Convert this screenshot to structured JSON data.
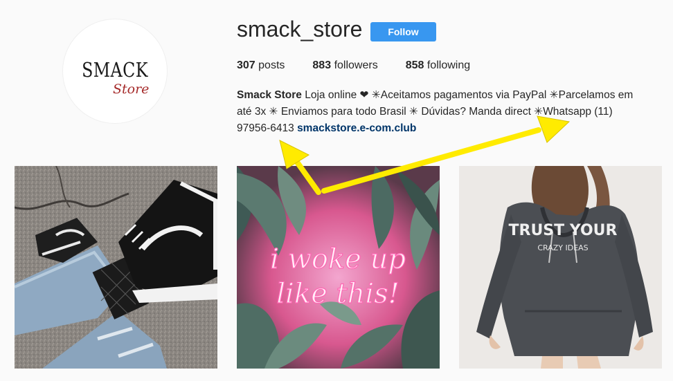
{
  "profile": {
    "username": "smack_store",
    "follow_label": "Follow",
    "avatar": {
      "logo_main": "SMACK",
      "logo_sub": "Store"
    }
  },
  "stats": {
    "posts_count": "307",
    "posts_label": "posts",
    "followers_count": "883",
    "followers_label": "followers",
    "following_count": "858",
    "following_label": "following"
  },
  "bio": {
    "name": "Smack Store",
    "text_line1": " Loja online ❤ ✳Aceitamos pagamentos via PayPal ✳Parcelamos em",
    "text_line2": "até 3x ✳ Enviamos para todo Brasil ✳ Dúvidas? Manda direct ✳Whatsapp (11)",
    "text_line3": "97956-6413 ",
    "link": "smackstore.e-com.club"
  },
  "posts": [
    {
      "image_icon": "sneakers-photo-icon"
    },
    {
      "image_icon": "neon-sign-photo-icon",
      "neon_line1": "i woke up",
      "neon_line2": "like this!"
    },
    {
      "image_icon": "hoodie-photo-icon",
      "shirt_line1": "TRUST YOUR",
      "shirt_line2": "CRAZY IDEAS"
    }
  ],
  "colors": {
    "follow_button": "#3897f0",
    "link": "#003569",
    "annotation_arrows": "#ffeb00"
  }
}
